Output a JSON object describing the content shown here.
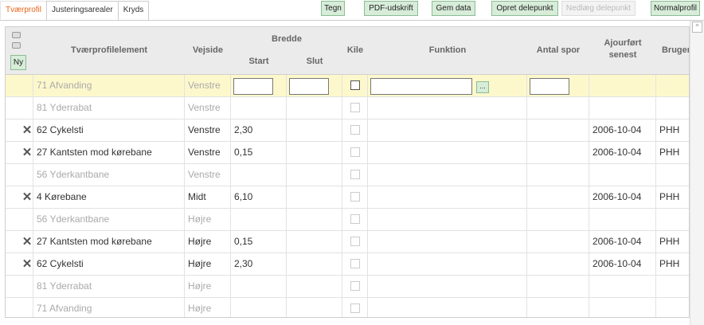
{
  "tabs": [
    {
      "label": "Tværprofil",
      "active": true
    },
    {
      "label": "Justeringsarealer",
      "active": false
    },
    {
      "label": "Kryds",
      "active": false
    }
  ],
  "toolbar": {
    "tegn": "Tegn",
    "pdf": "PDF-udskrift",
    "gem": "Gem data",
    "opret": "Opret delepunkt",
    "nedlaeg": "Nedlæg delepunkt",
    "normal": "Normalprofil"
  },
  "header": {
    "ny": "Ny",
    "element": "Tværprofilelement",
    "vejside": "Vejside",
    "bredde": "Bredde",
    "start": "Start",
    "slut": "Slut",
    "kile": "Kile",
    "funktion": "Funktion",
    "antal_spor": "Antal spor",
    "ajour_1": "Ajourført",
    "ajour_2": "senest",
    "bruger": "Bruger",
    "dots": "..."
  },
  "rows": [
    {
      "element": "71 Afvanding",
      "vejside": "Venstre",
      "start": "",
      "slut": "",
      "date": "",
      "user": "",
      "muted": true,
      "del": false,
      "editing": true
    },
    {
      "element": "81 Yderrabat",
      "vejside": "Venstre",
      "start": "",
      "slut": "",
      "date": "",
      "user": "",
      "muted": true,
      "del": false
    },
    {
      "element": "62 Cykelsti",
      "vejside": "Venstre",
      "start": "2,30",
      "slut": "",
      "date": "2006-10-04",
      "user": "PHH",
      "muted": false,
      "del": true
    },
    {
      "element": "27 Kantsten mod kørebane",
      "vejside": "Venstre",
      "start": "0,15",
      "slut": "",
      "date": "2006-10-04",
      "user": "PHH",
      "muted": false,
      "del": true
    },
    {
      "element": "56 Yderkantbane",
      "vejside": "Venstre",
      "start": "",
      "slut": "",
      "date": "",
      "user": "",
      "muted": true,
      "del": false
    },
    {
      "element": "4 Kørebane",
      "vejside": "Midt",
      "start": "6,10",
      "slut": "",
      "date": "2006-10-04",
      "user": "PHH",
      "muted": false,
      "del": true
    },
    {
      "element": "56 Yderkantbane",
      "vejside": "Højre",
      "start": "",
      "slut": "",
      "date": "",
      "user": "",
      "muted": true,
      "del": false
    },
    {
      "element": "27 Kantsten mod kørebane",
      "vejside": "Højre",
      "start": "0,15",
      "slut": "",
      "date": "2006-10-04",
      "user": "PHH",
      "muted": false,
      "del": true
    },
    {
      "element": "62 Cykelsti",
      "vejside": "Højre",
      "start": "2,30",
      "slut": "",
      "date": "2006-10-04",
      "user": "PHH",
      "muted": false,
      "del": true
    },
    {
      "element": "81 Yderrabat",
      "vejside": "Højre",
      "start": "",
      "slut": "",
      "date": "",
      "user": "",
      "muted": true,
      "del": false
    },
    {
      "element": "71 Afvanding",
      "vejside": "Højre",
      "start": "",
      "slut": "",
      "date": "",
      "user": "",
      "muted": true,
      "del": false
    }
  ]
}
